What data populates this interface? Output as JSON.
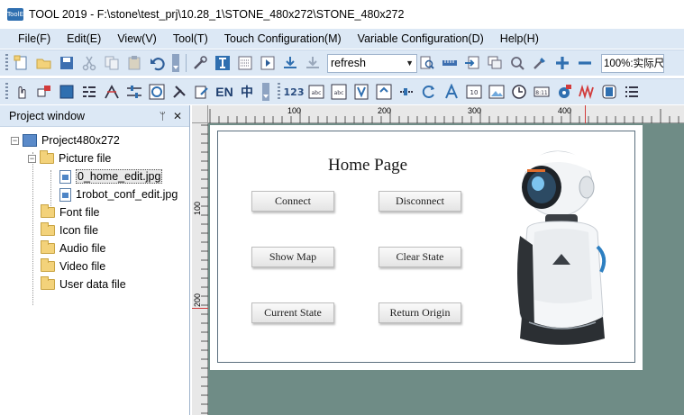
{
  "window": {
    "title": "TOOL 2019 - F:\\stone\\test_prj\\10.28_1\\STONE_480x272\\STONE_480x272",
    "app_icon_text": "ToolE"
  },
  "menu": {
    "items": [
      "File(F)",
      "Edit(E)",
      "View(V)",
      "Tool(T)",
      "Touch Configuration(M)",
      "Variable Configuration(D)",
      "Help(H)"
    ]
  },
  "toolbar": {
    "command_combo_value": "refresh",
    "zoom_value": "100%:实际尺",
    "en_label": "EN",
    "zh_label": "中",
    "num_label": "123",
    "abc_label": "abc"
  },
  "project_window": {
    "title": "Project window",
    "project_name": "Project480x272",
    "folders": {
      "picture": "Picture file",
      "font": "Font file",
      "icon": "Icon file",
      "audio": "Audio file",
      "video": "Video file",
      "user_data": "User data file"
    },
    "picture_files": [
      "0_home_edit.jpg",
      "1robot_conf_edit.jpg"
    ]
  },
  "ruler": {
    "top_labels": [
      "100",
      "200",
      "300",
      "400"
    ],
    "left_labels": [
      "100",
      "200"
    ]
  },
  "design": {
    "title": "Home Page",
    "buttons": {
      "connect": "Connect",
      "disconnect": "Disconnect",
      "show_map": "Show Map",
      "clear_state": "Clear State",
      "current_state": "Current State",
      "return_origin": "Return Origin"
    }
  },
  "colors": {
    "menubar_bg": "#dce8f5",
    "canvas_bg": "#6f8c86",
    "accent_blue": "#2f6fb0"
  }
}
